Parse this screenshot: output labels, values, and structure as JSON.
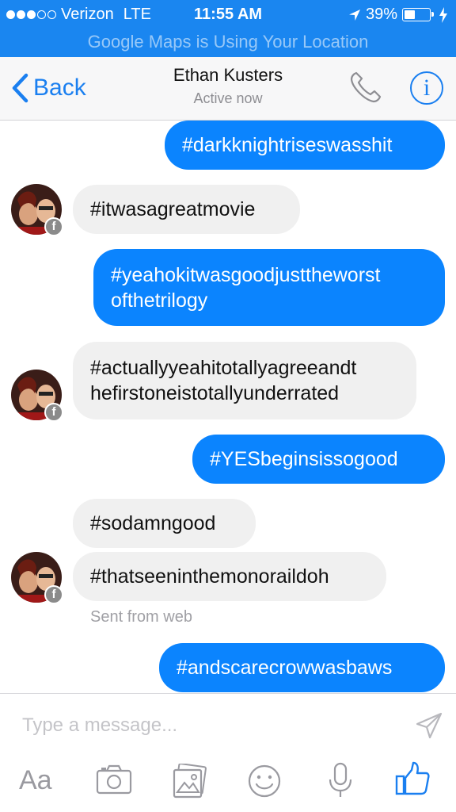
{
  "status_bar": {
    "carrier": "Verizon",
    "network": "LTE",
    "time": "11:55 AM",
    "battery": "39%",
    "signal_filled": 3,
    "signal_total": 5
  },
  "location_banner": "Google Maps is Using Your Location",
  "nav": {
    "back_label": "Back",
    "title": "Ethan Kusters",
    "subtitle": "Active now",
    "info_label": "i"
  },
  "messages": [
    {
      "direction": "outgoing",
      "text": "#darkknightriseswasshit"
    },
    {
      "direction": "incoming",
      "text": "#itwasagreatmovie"
    },
    {
      "direction": "outgoing",
      "line1": "#yeahokitwasgoodjusttheworst",
      "line2": "ofthetrilogy"
    },
    {
      "direction": "incoming",
      "line1": "#actuallyyeahitotallyagreeandt",
      "line2": "hefirstoneistotallyunderrated"
    },
    {
      "direction": "outgoing",
      "text": "#YESbeginsissogood"
    },
    {
      "direction": "incoming",
      "text": "#sodamngood"
    },
    {
      "direction": "incoming",
      "text": "#thatseeninthemonoraildoh"
    },
    {
      "direction": "outgoing",
      "text": "#andscarecrowwasbaws"
    }
  ],
  "sent_from": "Sent from web",
  "composer": {
    "placeholder": "Type a message...",
    "aa_label": "Aa",
    "fb_badge": "f"
  },
  "colors": {
    "accent": "#1a86f0",
    "outgoing_bubble": "#0b84fe",
    "incoming_bubble": "#f0f0f0"
  },
  "icons": {
    "back": "chevron-left-icon",
    "call": "phone-icon",
    "info": "info-icon",
    "send": "send-icon",
    "camera": "camera-icon",
    "gallery": "gallery-icon",
    "sticker": "smiley-icon",
    "voice": "microphone-icon",
    "like": "thumbs-up-icon"
  }
}
